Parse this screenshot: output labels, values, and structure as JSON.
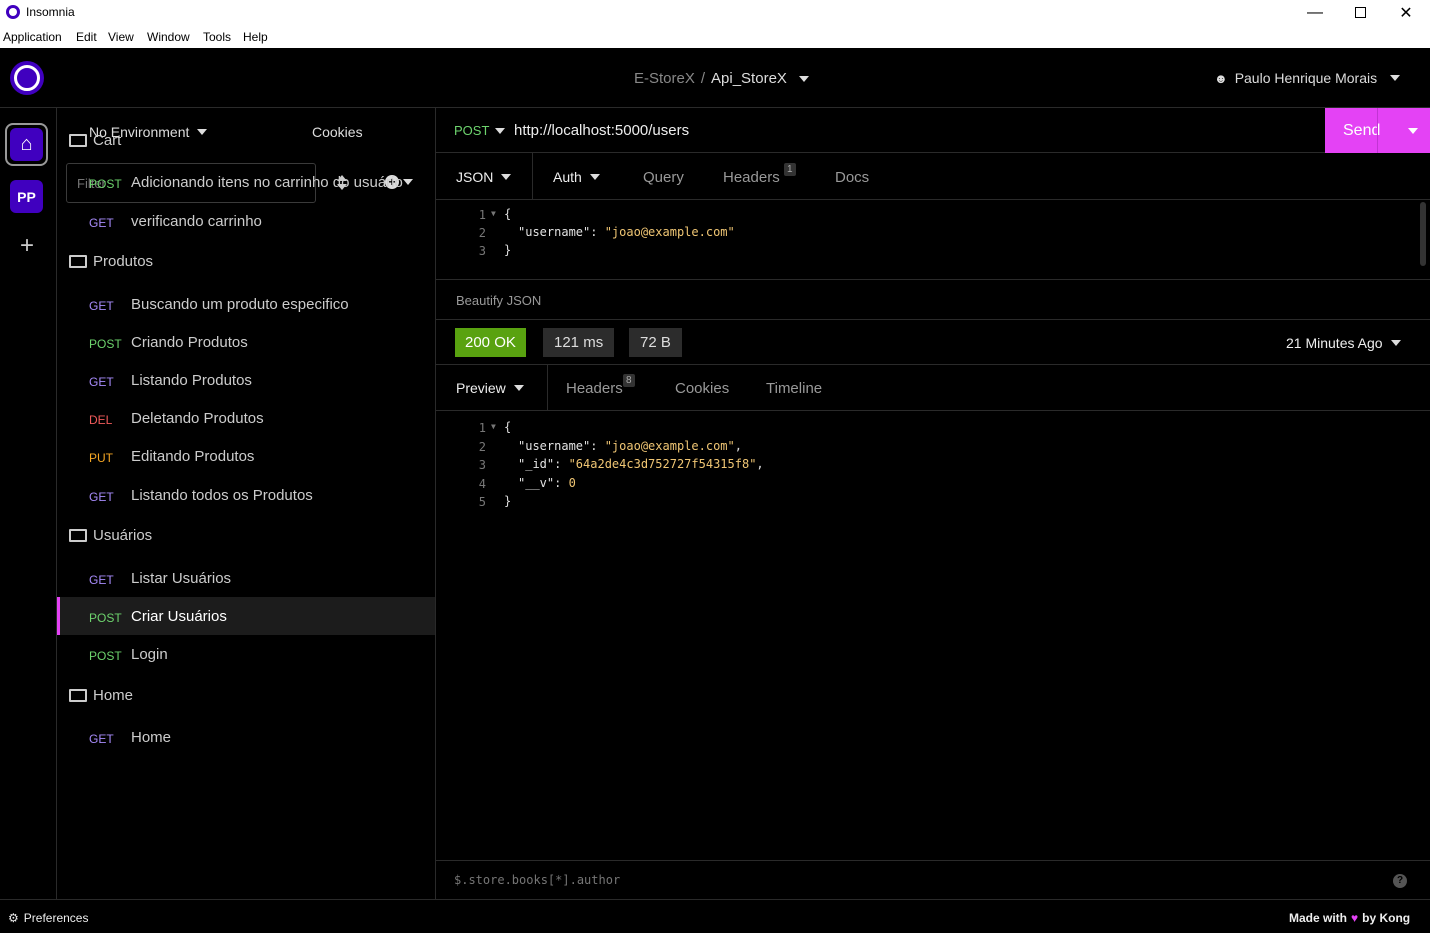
{
  "window": {
    "title": "Insomnia"
  },
  "menu": [
    "Application",
    "Edit",
    "View",
    "Window",
    "Tools",
    "Help"
  ],
  "header": {
    "project": "E-StoreX",
    "separator": "/",
    "collection": "Api_StoreX",
    "user": "Paulo Henrique Morais"
  },
  "nav": {
    "workspace_badge": "PP",
    "add": "+"
  },
  "sidebar": {
    "environment": "No Environment",
    "cookies": "Cookies",
    "filter_placeholder": "Filter",
    "folders": [
      {
        "name": "Cart",
        "items": [
          {
            "method": "POST",
            "name": "Adicionando itens no carrinho do usuário"
          },
          {
            "method": "GET",
            "name": "verificando carrinho"
          }
        ]
      },
      {
        "name": "Produtos",
        "items": [
          {
            "method": "GET",
            "name": "Buscando um produto especifico"
          },
          {
            "method": "POST",
            "name": "Criando Produtos"
          },
          {
            "method": "GET",
            "name": "Listando Produtos"
          },
          {
            "method": "DEL",
            "name": "Deletando Produtos"
          },
          {
            "method": "PUT",
            "name": "Editando Produtos"
          },
          {
            "method": "GET",
            "name": "Listando todos os Produtos"
          }
        ]
      },
      {
        "name": "Usuários",
        "items": [
          {
            "method": "GET",
            "name": "Listar Usuários"
          },
          {
            "method": "POST",
            "name": "Criar Usuários"
          },
          {
            "method": "POST",
            "name": "Login"
          }
        ]
      },
      {
        "name": "Home",
        "items": [
          {
            "method": "GET",
            "name": "Home"
          }
        ]
      }
    ]
  },
  "request": {
    "method": "POST",
    "url": "http://localhost:5000/users",
    "send": "Send",
    "tabs": {
      "body": "JSON",
      "auth": "Auth",
      "query": "Query",
      "headers": "Headers",
      "headers_count": "1",
      "docs": "Docs"
    },
    "body_lines": [
      {
        "n": "1",
        "text": "{"
      },
      {
        "n": "2",
        "key": "\"username\"",
        "value": "\"joao@example.com\""
      },
      {
        "n": "3",
        "text": "}"
      }
    ],
    "beautify": "Beautify JSON"
  },
  "response": {
    "status": "200 OK",
    "time": "121 ms",
    "size": "72 B",
    "history": "21 Minutes Ago",
    "tabs": {
      "preview": "Preview",
      "headers": "Headers",
      "headers_count": "8",
      "cookies": "Cookies",
      "timeline": "Timeline"
    },
    "body_lines": [
      {
        "n": "1",
        "text": "{"
      },
      {
        "n": "2",
        "key": "\"username\"",
        "value": "\"joao@example.com\"",
        "comma": ","
      },
      {
        "n": "3",
        "key": "\"_id\"",
        "value": "\"64a2de4c3d752727f54315f8\"",
        "comma": ","
      },
      {
        "n": "4",
        "key": "\"__v\"",
        "value": "0",
        "comma": ""
      },
      {
        "n": "5",
        "text": "}"
      }
    ],
    "filter_placeholder": "$.store.books[*].author",
    "help": "?"
  },
  "status": {
    "preferences": "Preferences",
    "made_with": "Made with",
    "by": "by Kong"
  },
  "colors": {
    "accent": "#e442f5",
    "success": "#59a210",
    "brand": "#4000bf"
  }
}
